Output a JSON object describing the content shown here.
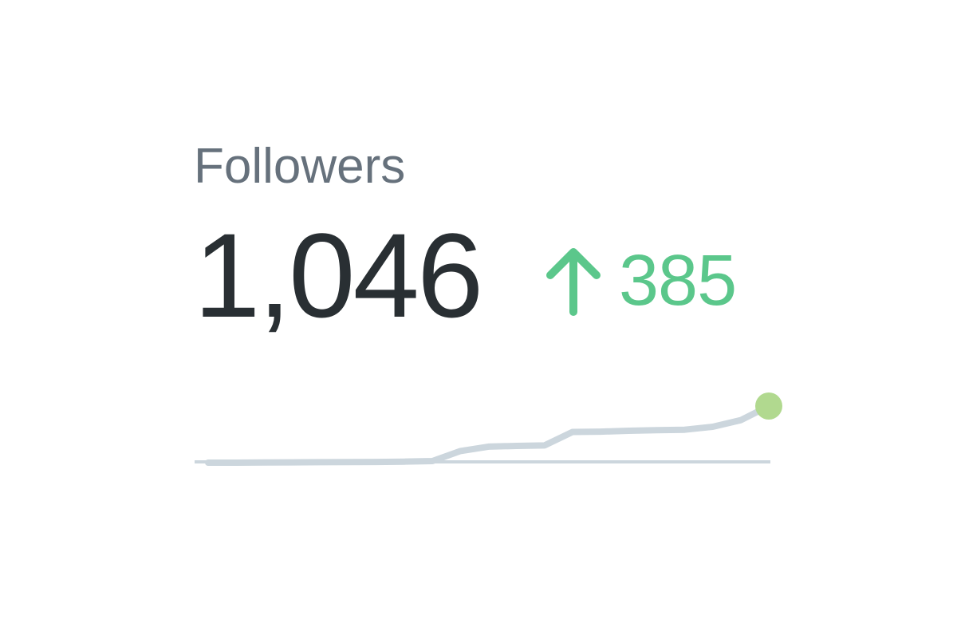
{
  "metric": {
    "label": "Followers",
    "count": "1,046",
    "change": "385",
    "change_direction": "up",
    "change_icon": "arrow-up-icon",
    "colors": {
      "label": "#66717c",
      "count": "#292f33",
      "change": "#5bc78b",
      "sparkline": "#ccd6dd",
      "baseline": "#ccd6dd",
      "endpoint": "#b1d98f"
    }
  },
  "chart_data": {
    "type": "line",
    "title": "",
    "xlabel": "",
    "ylabel": "",
    "grid": false,
    "x": [
      0,
      1,
      2,
      3,
      4,
      5,
      6,
      7,
      8,
      9,
      10,
      11,
      12,
      13,
      14,
      15,
      16,
      17,
      18,
      19,
      20
    ],
    "series": [
      {
        "values": [
          661,
          661,
          662,
          663,
          664,
          665,
          666,
          668,
          672,
          740,
          770,
          775,
          778,
          870,
          872,
          878,
          882,
          885,
          905,
          950,
          1046
        ]
      }
    ]
  }
}
